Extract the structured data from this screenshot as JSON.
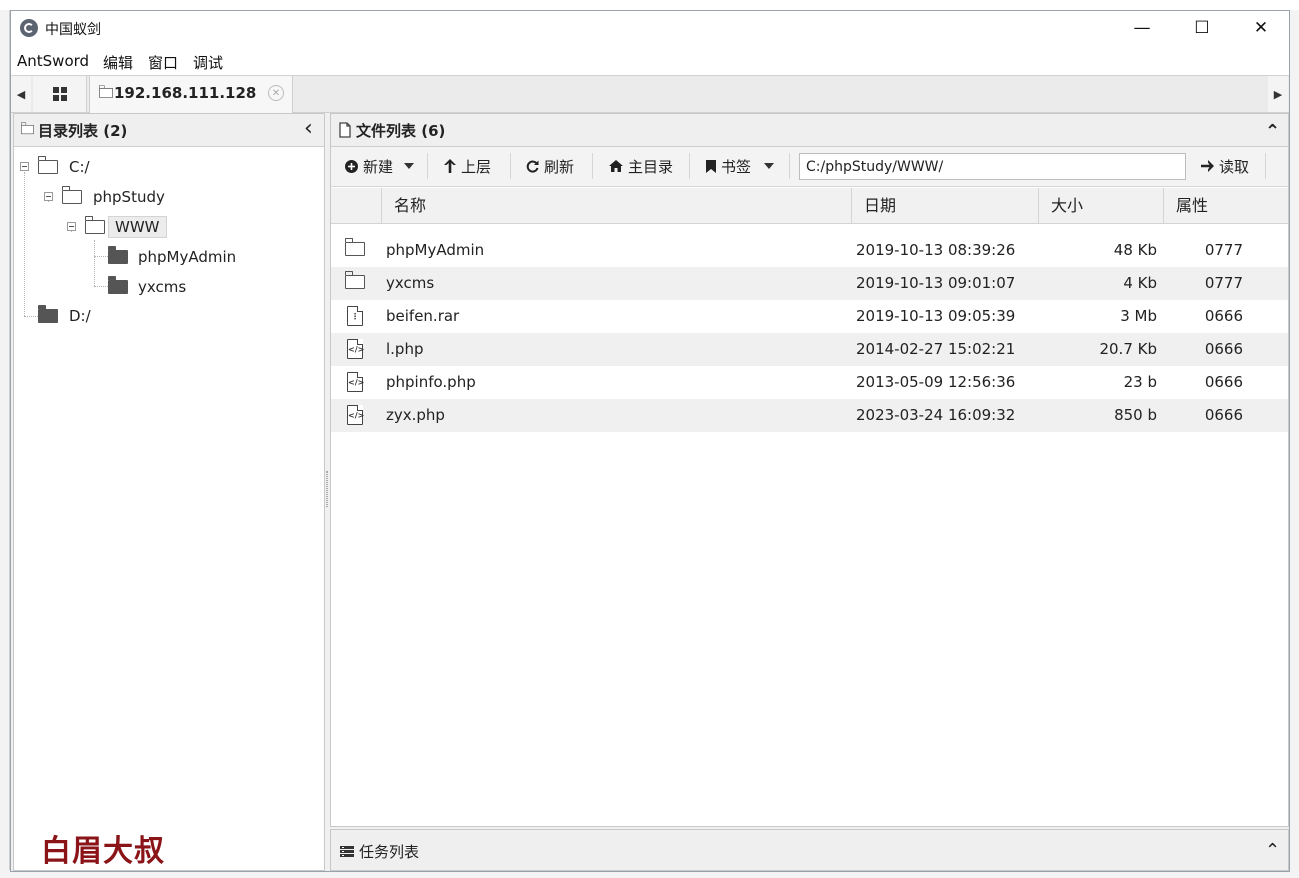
{
  "window": {
    "title": "中国蚁剑",
    "minimize": "—",
    "maximize": "☐",
    "close": "✕"
  },
  "menu": [
    "AntSword",
    "编辑",
    "窗口",
    "调试"
  ],
  "tabs": {
    "prev": "◀",
    "next": "▶",
    "active_label": "192.168.111.128",
    "close": "✕"
  },
  "dir_panel": {
    "title": "目录列表 (2)",
    "collapse": "‹",
    "tree": [
      {
        "label": "C:/",
        "level": 0,
        "icon": "folder-open-icon",
        "expanded": true
      },
      {
        "label": "phpStudy",
        "level": 1,
        "icon": "folder-open-icon",
        "expanded": true
      },
      {
        "label": "WWW",
        "level": 2,
        "icon": "folder-open-icon",
        "expanded": true,
        "selected": true
      },
      {
        "label": "phpMyAdmin",
        "level": 3,
        "icon": "folder-icon"
      },
      {
        "label": "yxcms",
        "level": 3,
        "icon": "folder-icon"
      },
      {
        "label": "D:/",
        "level": 0,
        "icon": "folder-icon"
      }
    ]
  },
  "file_panel": {
    "title": "文件列表 (6)",
    "collapse": "⌃",
    "toolbar": {
      "new": "新建",
      "up": "上层",
      "refresh": "刷新",
      "home": "主目录",
      "bookmark": "书签",
      "path": "C:/phpStudy/WWW/",
      "read": "读取"
    },
    "columns": [
      "名称",
      "日期",
      "大小",
      "属性"
    ],
    "rows": [
      {
        "icon": "folder-icon",
        "name": "phpMyAdmin",
        "date": "2019-10-13 08:39:26",
        "size": "48 Kb",
        "attr": "0777"
      },
      {
        "icon": "folder-icon",
        "name": "yxcms",
        "date": "2019-10-13 09:01:07",
        "size": "4 Kb",
        "attr": "0777"
      },
      {
        "icon": "archive-file-icon",
        "name": "beifen.rar",
        "date": "2019-10-13 09:05:39",
        "size": "3 Mb",
        "attr": "0666"
      },
      {
        "icon": "code-file-icon",
        "name": "l.php",
        "date": "2014-02-27 15:02:21",
        "size": "20.7 Kb",
        "attr": "0666"
      },
      {
        "icon": "code-file-icon",
        "name": "phpinfo.php",
        "date": "2013-05-09 12:56:36",
        "size": "23 b",
        "attr": "0666"
      },
      {
        "icon": "code-file-icon",
        "name": "zyx.php",
        "date": "2023-03-24 16:09:32",
        "size": "850 b",
        "attr": "0666"
      }
    ]
  },
  "task_panel": {
    "title": "任务列表",
    "collapse": "⌃"
  },
  "watermark": "白眉大叔",
  "colors": {
    "accent": "#8b1418",
    "row_alt": "#f0f0f0",
    "header_bg": "#efefef"
  }
}
